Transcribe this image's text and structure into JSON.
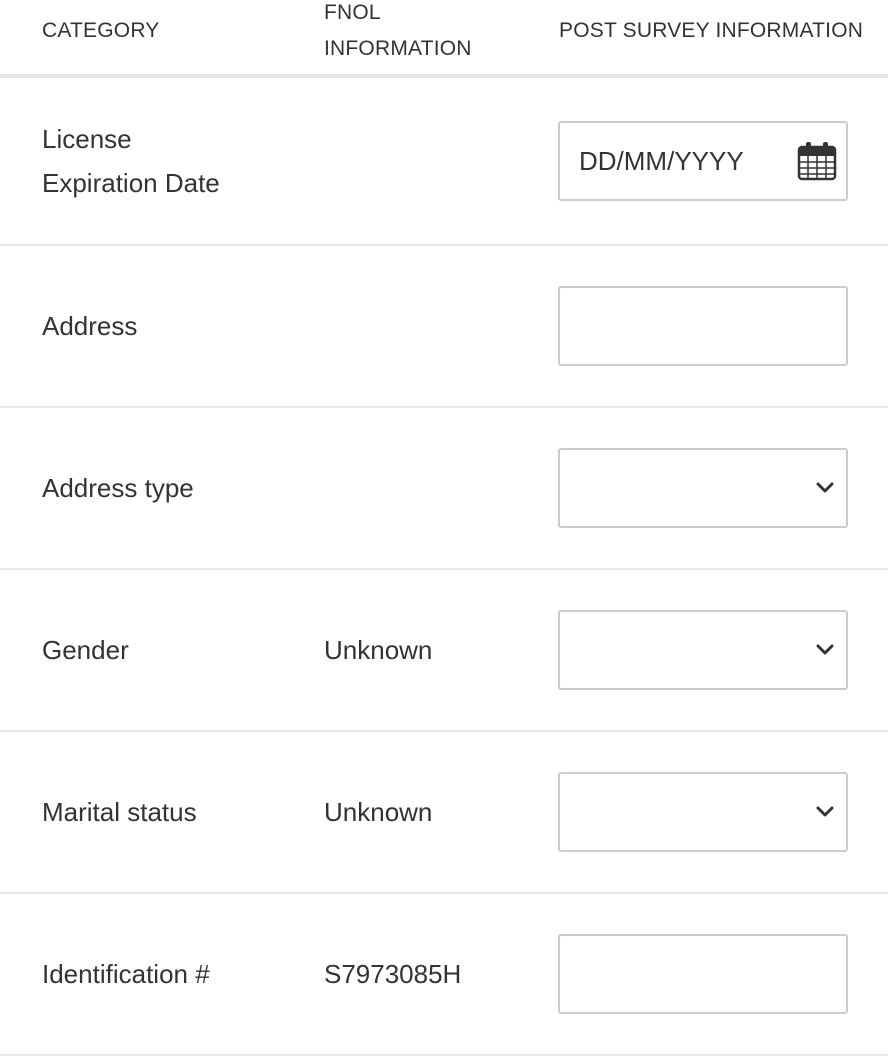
{
  "header": {
    "category": "CATEGORY",
    "fnol_line1": "FNOL",
    "fnol_line2": "INFORMATION",
    "post_survey": "POST SURVEY INFORMATION"
  },
  "rows": [
    {
      "label_line1": "License",
      "label_line2": "Expiration Date",
      "fnol": "",
      "field_type": "date",
      "placeholder": "DD/MM/YYYY",
      "value": "",
      "icon": "calendar-icon"
    },
    {
      "label": "Address",
      "fnol": "",
      "field_type": "text",
      "value": ""
    },
    {
      "label": "Address type",
      "fnol": "",
      "field_type": "select",
      "selected": "",
      "icon": "chevron-down-icon"
    },
    {
      "label": "Gender",
      "fnol": "Unknown",
      "field_type": "select",
      "selected": "",
      "icon": "chevron-down-icon"
    },
    {
      "label": "Marital status",
      "fnol": "Unknown",
      "field_type": "select",
      "selected": "",
      "icon": "chevron-down-icon"
    },
    {
      "label": "Identification #",
      "fnol": "S7973085H",
      "field_type": "text",
      "value": ""
    }
  ],
  "colors": {
    "text": "#333333",
    "border": "#cccccc",
    "divider": "#e6e6e6"
  }
}
